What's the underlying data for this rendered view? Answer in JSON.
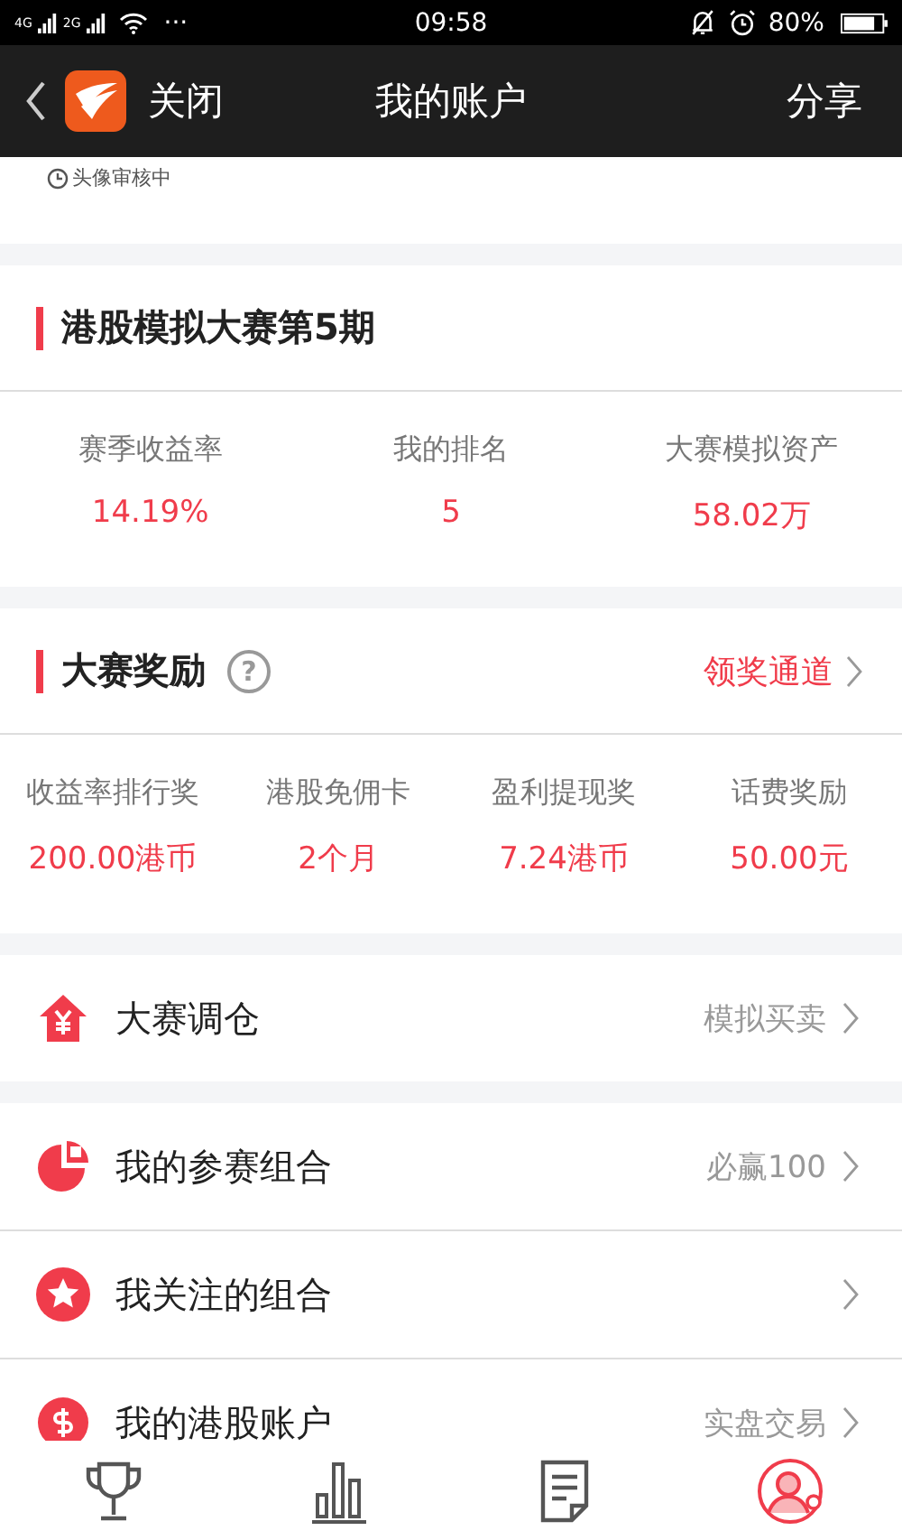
{
  "status_bar": {
    "network_1": "4G",
    "network_2": "2G",
    "dots": "···",
    "time": "09:58",
    "battery": "80%"
  },
  "header": {
    "back": "关闭",
    "title": "我的账户",
    "action": "分享"
  },
  "profile": {
    "review_status": "头像审核中"
  },
  "contest": {
    "title": "港股模拟大赛第5期",
    "stats": [
      {
        "label": "赛季收益率",
        "value": "14.19%"
      },
      {
        "label": "我的排名",
        "value": "5"
      },
      {
        "label": "大赛模拟资产",
        "value": "58.02万"
      }
    ]
  },
  "rewards": {
    "title": "大赛奖励",
    "help": "?",
    "link": "领奖通道",
    "items": [
      {
        "label": "收益率排行奖",
        "value": "200.00港币"
      },
      {
        "label": "港股免佣卡",
        "value": "2个月"
      },
      {
        "label": "盈利提现奖",
        "value": "7.24港币"
      },
      {
        "label": "话费奖励",
        "value": "50.00元"
      }
    ]
  },
  "menu": [
    {
      "kind": "house",
      "label": "大赛调仓",
      "detail": "模拟买卖",
      "gap_before": true
    },
    {
      "kind": "pie",
      "label": "我的参赛组合",
      "detail": "必赢100",
      "gap_before": true
    },
    {
      "kind": "star",
      "label": "我关注的组合",
      "gap_before": false
    },
    {
      "kind": "coin",
      "label": "我的港股账户",
      "detail": "实盘交易",
      "gap_before": false
    }
  ],
  "tab_bar": [
    {
      "kind": "trophy",
      "selected": false
    },
    {
      "kind": "chart",
      "selected": false
    },
    {
      "kind": "document",
      "selected": false
    },
    {
      "kind": "user",
      "selected": true
    }
  ]
}
